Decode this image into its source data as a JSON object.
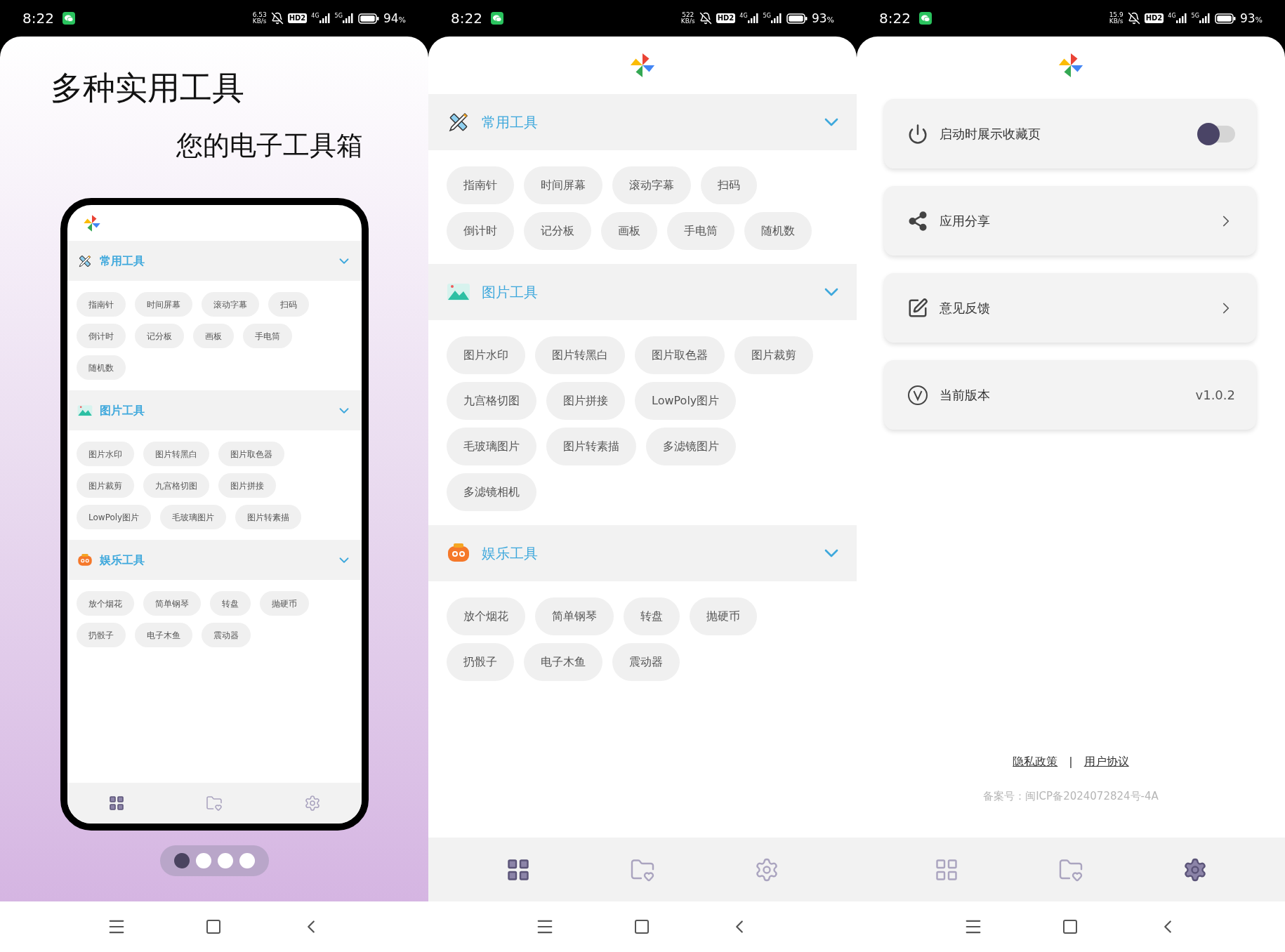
{
  "status_bars": [
    {
      "time": "8:22",
      "speed": "6.53",
      "speed_unit": "KB/s",
      "hd": "HD2",
      "net_a": "4G",
      "net_b": "5G",
      "battery": "94",
      "battery_unit": "%"
    },
    {
      "time": "8:22",
      "speed": "522",
      "speed_unit": "KB/s",
      "hd": "HD2",
      "net_a": "4G",
      "net_b": "5G",
      "battery": "93",
      "battery_unit": "%"
    },
    {
      "time": "8:22",
      "speed": "15.9",
      "speed_unit": "KB/s",
      "hd": "HD2",
      "net_a": "4G",
      "net_b": "5G",
      "battery": "93",
      "battery_unit": "%"
    }
  ],
  "intro": {
    "title": "多种实用工具",
    "subtitle": "您的电子工具箱",
    "mockup": {
      "sections": [
        {
          "kind": "tools",
          "title": "常用工具",
          "expanded": true,
          "rows": [
            [
              "指南针",
              "时间屏幕",
              "滚动字幕",
              "扫码"
            ],
            [
              "倒计时",
              "记分板",
              "画板",
              "手电筒"
            ],
            [
              "随机数"
            ]
          ]
        },
        {
          "kind": "image",
          "title": "图片工具",
          "expanded": true,
          "rows": [
            [
              "图片水印",
              "图片转黑白",
              "图片取色器"
            ],
            [
              "图片裁剪",
              "九宫格切图",
              "图片拼接"
            ],
            [
              "LowPoly图片",
              "毛玻璃图片",
              "图片转素描"
            ]
          ]
        },
        {
          "kind": "fun",
          "title": "娱乐工具",
          "expanded": true,
          "rows": [
            [
              "放个烟花",
              "简单钢琴",
              "转盘",
              "抛硬币"
            ],
            [
              "扔骰子",
              "电子木鱼",
              "震动器"
            ]
          ]
        }
      ],
      "tabs": [
        {
          "kind": "grid",
          "selected": true
        },
        {
          "kind": "folder",
          "selected": false
        },
        {
          "kind": "settings",
          "selected": false
        }
      ]
    },
    "pager": [
      {
        "selected": true
      },
      {
        "selected": false
      },
      {
        "selected": false
      },
      {
        "selected": false
      }
    ]
  },
  "tools_screen": {
    "sections": [
      {
        "kind": "tools",
        "title": "常用工具",
        "expanded": true,
        "rows": [
          [
            "指南针",
            "时间屏幕",
            "滚动字幕",
            "扫码"
          ],
          [
            "倒计时",
            "记分板",
            "画板",
            "手电筒",
            "随机数"
          ]
        ]
      },
      {
        "kind": "image",
        "title": "图片工具",
        "expanded": true,
        "rows": [
          [
            "图片水印",
            "图片转黑白",
            "图片取色器",
            "图片裁剪"
          ],
          [
            "九宫格切图",
            "图片拼接",
            "LowPoly图片"
          ],
          [
            "毛玻璃图片",
            "图片转素描",
            "多滤镜图片"
          ],
          [
            "多滤镜相机"
          ]
        ]
      },
      {
        "kind": "fun",
        "title": "娱乐工具",
        "expanded": true,
        "rows": [
          [
            "放个烟花",
            "简单钢琴",
            "转盘",
            "抛硬币"
          ],
          [
            "扔骰子",
            "电子木鱼",
            "震动器"
          ]
        ]
      }
    ],
    "tabs": [
      {
        "kind": "grid",
        "selected": true
      },
      {
        "kind": "folder",
        "selected": false
      },
      {
        "kind": "settings",
        "selected": false
      }
    ]
  },
  "settings_screen": {
    "items": [
      {
        "kind": "toggle",
        "label": "启动时展示收藏页",
        "on": false
      },
      {
        "kind": "link",
        "label": "应用分享"
      },
      {
        "kind": "link",
        "label": "意见反馈"
      },
      {
        "kind": "version",
        "label": "当前版本",
        "value": "v1.0.2"
      }
    ],
    "links": [
      "隐私政策",
      "用户协议"
    ],
    "separator": "|",
    "icp": "备案号：闽ICP备2024072824号-4A",
    "tabs": [
      {
        "kind": "grid",
        "selected": false
      },
      {
        "kind": "folder",
        "selected": false
      },
      {
        "kind": "settings",
        "selected": true
      }
    ]
  }
}
